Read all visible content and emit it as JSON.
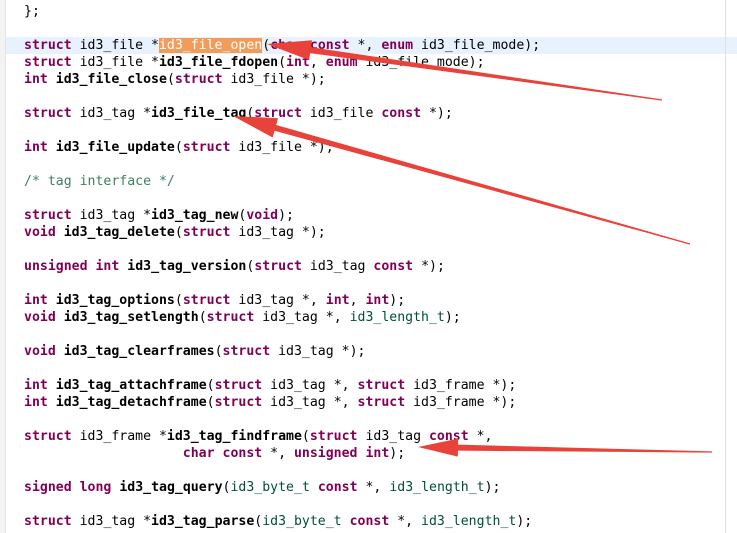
{
  "editor": {
    "lines": [
      [
        {
          "t": "};",
          "c": "pl"
        }
      ],
      [],
      [
        {
          "t": "struct",
          "c": "kw"
        },
        {
          "t": " id3_file *",
          "c": "pl"
        },
        {
          "t": "id3_file_open",
          "c": "hl"
        },
        {
          "t": "(",
          "c": "pl"
        },
        {
          "t": "char",
          "c": "kw"
        },
        {
          "t": " ",
          "c": "pl"
        },
        {
          "t": "const",
          "c": "kw"
        },
        {
          "t": " *, ",
          "c": "pl"
        },
        {
          "t": "enum",
          "c": "kw"
        },
        {
          "t": " id3_file_mode);",
          "c": "pl"
        }
      ],
      [
        {
          "t": "struct",
          "c": "kw"
        },
        {
          "t": " id3_file *",
          "c": "pl"
        },
        {
          "t": "id3_file_fdopen",
          "c": "fn"
        },
        {
          "t": "(",
          "c": "pl"
        },
        {
          "t": "int",
          "c": "kw"
        },
        {
          "t": ", ",
          "c": "pl"
        },
        {
          "t": "enum",
          "c": "kw"
        },
        {
          "t": " id3_file_mode);",
          "c": "pl"
        }
      ],
      [
        {
          "t": "int",
          "c": "kw"
        },
        {
          "t": " ",
          "c": "pl"
        },
        {
          "t": "id3_file_close",
          "c": "fn"
        },
        {
          "t": "(",
          "c": "pl"
        },
        {
          "t": "struct",
          "c": "kw"
        },
        {
          "t": " id3_file *);",
          "c": "pl"
        }
      ],
      [],
      [
        {
          "t": "struct",
          "c": "kw"
        },
        {
          "t": " id3_tag *",
          "c": "pl"
        },
        {
          "t": "id3_file_tag",
          "c": "fn"
        },
        {
          "t": "(",
          "c": "pl"
        },
        {
          "t": "struct",
          "c": "kw"
        },
        {
          "t": " id3_file ",
          "c": "pl"
        },
        {
          "t": "const",
          "c": "kw"
        },
        {
          "t": " *);",
          "c": "pl"
        }
      ],
      [],
      [
        {
          "t": "int",
          "c": "kw"
        },
        {
          "t": " ",
          "c": "pl"
        },
        {
          "t": "id3_file_update",
          "c": "fn"
        },
        {
          "t": "(",
          "c": "pl"
        },
        {
          "t": "struct",
          "c": "kw"
        },
        {
          "t": " id3_file *);",
          "c": "pl"
        }
      ],
      [],
      [
        {
          "t": "/* tag interface */",
          "c": "cm"
        }
      ],
      [],
      [
        {
          "t": "struct",
          "c": "kw"
        },
        {
          "t": " id3_tag *",
          "c": "pl"
        },
        {
          "t": "id3_tag_new",
          "c": "fn"
        },
        {
          "t": "(",
          "c": "pl"
        },
        {
          "t": "void",
          "c": "kw"
        },
        {
          "t": ");",
          "c": "pl"
        }
      ],
      [
        {
          "t": "void",
          "c": "kw"
        },
        {
          "t": " ",
          "c": "pl"
        },
        {
          "t": "id3_tag_delete",
          "c": "fn"
        },
        {
          "t": "(",
          "c": "pl"
        },
        {
          "t": "struct",
          "c": "kw"
        },
        {
          "t": " id3_tag *);",
          "c": "pl"
        }
      ],
      [],
      [
        {
          "t": "unsigned",
          "c": "kw"
        },
        {
          "t": " ",
          "c": "pl"
        },
        {
          "t": "int",
          "c": "kw"
        },
        {
          "t": " ",
          "c": "pl"
        },
        {
          "t": "id3_tag_version",
          "c": "fn"
        },
        {
          "t": "(",
          "c": "pl"
        },
        {
          "t": "struct",
          "c": "kw"
        },
        {
          "t": " id3_tag ",
          "c": "pl"
        },
        {
          "t": "const",
          "c": "kw"
        },
        {
          "t": " *);",
          "c": "pl"
        }
      ],
      [],
      [
        {
          "t": "int",
          "c": "kw"
        },
        {
          "t": " ",
          "c": "pl"
        },
        {
          "t": "id3_tag_options",
          "c": "fn"
        },
        {
          "t": "(",
          "c": "pl"
        },
        {
          "t": "struct",
          "c": "kw"
        },
        {
          "t": " id3_tag *, ",
          "c": "pl"
        },
        {
          "t": "int",
          "c": "kw"
        },
        {
          "t": ", ",
          "c": "pl"
        },
        {
          "t": "int",
          "c": "kw"
        },
        {
          "t": ");",
          "c": "pl"
        }
      ],
      [
        {
          "t": "void",
          "c": "kw"
        },
        {
          "t": " ",
          "c": "pl"
        },
        {
          "t": "id3_tag_setlength",
          "c": "fn"
        },
        {
          "t": "(",
          "c": "pl"
        },
        {
          "t": "struct",
          "c": "kw"
        },
        {
          "t": " id3_tag *, ",
          "c": "pl"
        },
        {
          "t": "id3_length_t",
          "c": "ty"
        },
        {
          "t": ");",
          "c": "pl"
        }
      ],
      [],
      [
        {
          "t": "void",
          "c": "kw"
        },
        {
          "t": " ",
          "c": "pl"
        },
        {
          "t": "id3_tag_clearframes",
          "c": "fn"
        },
        {
          "t": "(",
          "c": "pl"
        },
        {
          "t": "struct",
          "c": "kw"
        },
        {
          "t": " id3_tag *);",
          "c": "pl"
        }
      ],
      [],
      [
        {
          "t": "int",
          "c": "kw"
        },
        {
          "t": " ",
          "c": "pl"
        },
        {
          "t": "id3_tag_attachframe",
          "c": "fn"
        },
        {
          "t": "(",
          "c": "pl"
        },
        {
          "t": "struct",
          "c": "kw"
        },
        {
          "t": " id3_tag *, ",
          "c": "pl"
        },
        {
          "t": "struct",
          "c": "kw"
        },
        {
          "t": " id3_frame *);",
          "c": "pl"
        }
      ],
      [
        {
          "t": "int",
          "c": "kw"
        },
        {
          "t": " ",
          "c": "pl"
        },
        {
          "t": "id3_tag_detachframe",
          "c": "fn"
        },
        {
          "t": "(",
          "c": "pl"
        },
        {
          "t": "struct",
          "c": "kw"
        },
        {
          "t": " id3_tag *, ",
          "c": "pl"
        },
        {
          "t": "struct",
          "c": "kw"
        },
        {
          "t": " id3_frame *);",
          "c": "pl"
        }
      ],
      [],
      [
        {
          "t": "struct",
          "c": "kw"
        },
        {
          "t": " id3_frame *",
          "c": "pl"
        },
        {
          "t": "id3_tag_findframe",
          "c": "fn"
        },
        {
          "t": "(",
          "c": "pl"
        },
        {
          "t": "struct",
          "c": "kw"
        },
        {
          "t": " id3_tag ",
          "c": "pl"
        },
        {
          "t": "const",
          "c": "kw"
        },
        {
          "t": " *,",
          "c": "pl"
        }
      ],
      [
        {
          "t": "                    ",
          "c": "pl"
        },
        {
          "t": "char",
          "c": "kw"
        },
        {
          "t": " ",
          "c": "pl"
        },
        {
          "t": "const",
          "c": "kw"
        },
        {
          "t": " *, ",
          "c": "pl"
        },
        {
          "t": "unsigned",
          "c": "kw"
        },
        {
          "t": " ",
          "c": "pl"
        },
        {
          "t": "int",
          "c": "kw"
        },
        {
          "t": ");",
          "c": "pl"
        }
      ],
      [],
      [
        {
          "t": "signed",
          "c": "kw"
        },
        {
          "t": " ",
          "c": "pl"
        },
        {
          "t": "long",
          "c": "kw"
        },
        {
          "t": " ",
          "c": "pl"
        },
        {
          "t": "id3_tag_query",
          "c": "fn"
        },
        {
          "t": "(",
          "c": "pl"
        },
        {
          "t": "id3_byte_t",
          "c": "ty"
        },
        {
          "t": " ",
          "c": "pl"
        },
        {
          "t": "const",
          "c": "kw"
        },
        {
          "t": " *, ",
          "c": "pl"
        },
        {
          "t": "id3_length_t",
          "c": "ty"
        },
        {
          "t": ");",
          "c": "pl"
        }
      ],
      [],
      [
        {
          "t": "struct",
          "c": "kw"
        },
        {
          "t": " id3_tag *",
          "c": "pl"
        },
        {
          "t": "id3_tag_parse",
          "c": "fn"
        },
        {
          "t": "(",
          "c": "pl"
        },
        {
          "t": "id3_byte_t",
          "c": "ty"
        },
        {
          "t": " ",
          "c": "pl"
        },
        {
          "t": "const",
          "c": "kw"
        },
        {
          "t": " *, ",
          "c": "pl"
        },
        {
          "t": "id3_length_t",
          "c": "ty"
        },
        {
          "t": ");",
          "c": "pl"
        }
      ]
    ]
  },
  "annotations": {
    "arrow_color": "#e8423a"
  }
}
